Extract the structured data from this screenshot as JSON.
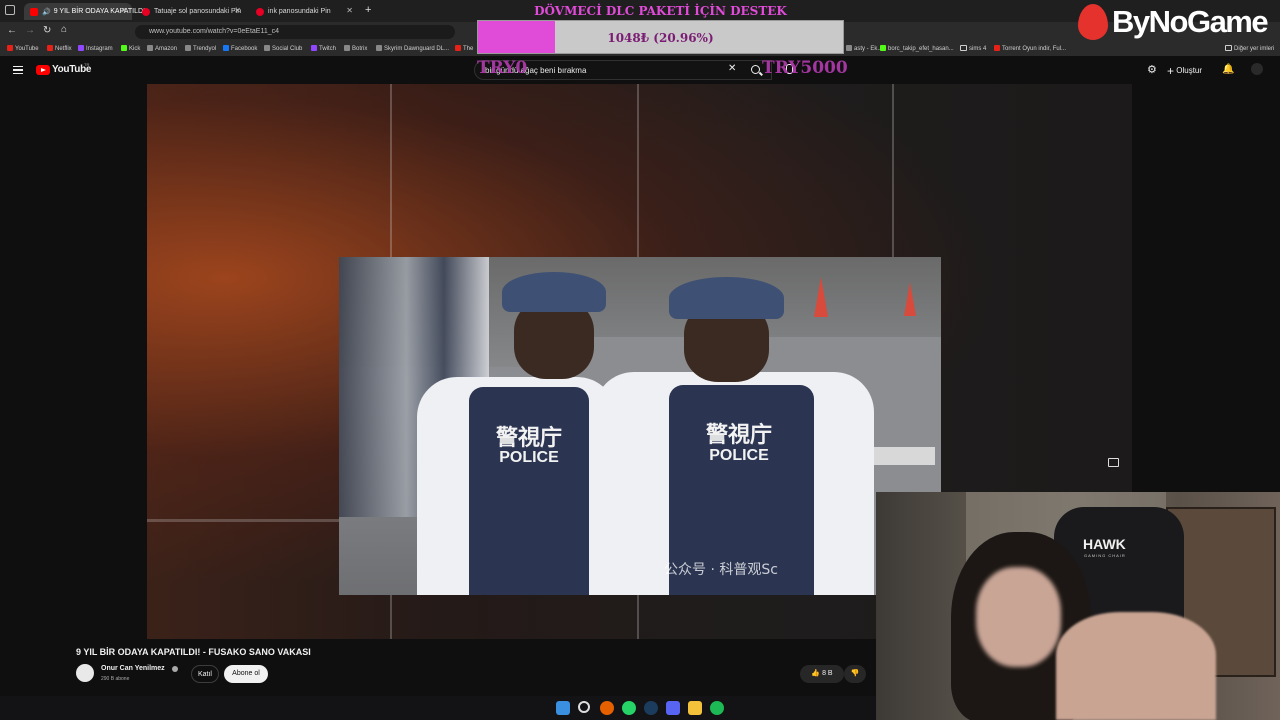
{
  "browser": {
    "tabs": [
      {
        "label": "9 YIL BİR ODAYA KAPATILDI",
        "active": true
      },
      {
        "label": "Tatuaje sol panosundaki Pin",
        "active": false
      },
      {
        "label": "ink panosundaki Pin",
        "active": false
      }
    ],
    "new_tab": "+",
    "url": "www.youtube.com/watch?v=0eEtaE11_c4",
    "bookmarks": [
      "YouTube",
      "Netflix",
      "Instagram",
      "Kick",
      "Amazon",
      "Trendyol",
      "Facebook",
      "Social Club",
      "Twitch",
      "Botrix",
      "Skyrim Dawnguard DL...",
      "The"
    ],
    "bookmarks_right": [
      "asty - Ek...",
      "borc_takip_efet_hasan...",
      "sims 4",
      "Torrent Oyun indir, Ful..."
    ],
    "other_bookmarks": "Diğer yer imleri"
  },
  "overlay": {
    "donation_title": "DÖVMECİ DLC PAKETİ İÇİN DESTEK",
    "progress_text": "1048₺ (20.96%)",
    "progress_percent": 20.96,
    "goal_min": "TRY0",
    "goal_max": "TRY5000",
    "brand": "ByNoGame"
  },
  "youtube": {
    "logo": "YouTube",
    "logo_country": "TR",
    "search_value": "bir gündü ağaç beni bırakma",
    "create_label": "Oluştur",
    "video_title": "9 YIL BİR ODAYA KAPATILDI! - FUSAKO SANO VAKASI",
    "channel_name": "Onur Can Yenilmez",
    "subscribers": "290 B abone",
    "join_label": "Katıl",
    "subscribe_label": "Abone ol",
    "like_count": "8 B"
  },
  "video_frame": {
    "vest_kanji_1": "警視庁",
    "vest_label_1": "POLICE",
    "vest_kanji_2": "警視庁",
    "vest_label_2": "POLICE",
    "watermark": "公众号 · 科普观Sc"
  },
  "webcam": {
    "chair_brand": "HAWK",
    "chair_subtitle": "GAMING CHAIR"
  },
  "colors": {
    "accent_pink": "#e04bd8",
    "youtube_red": "#ff0000",
    "bg": "#0f0f0f"
  }
}
